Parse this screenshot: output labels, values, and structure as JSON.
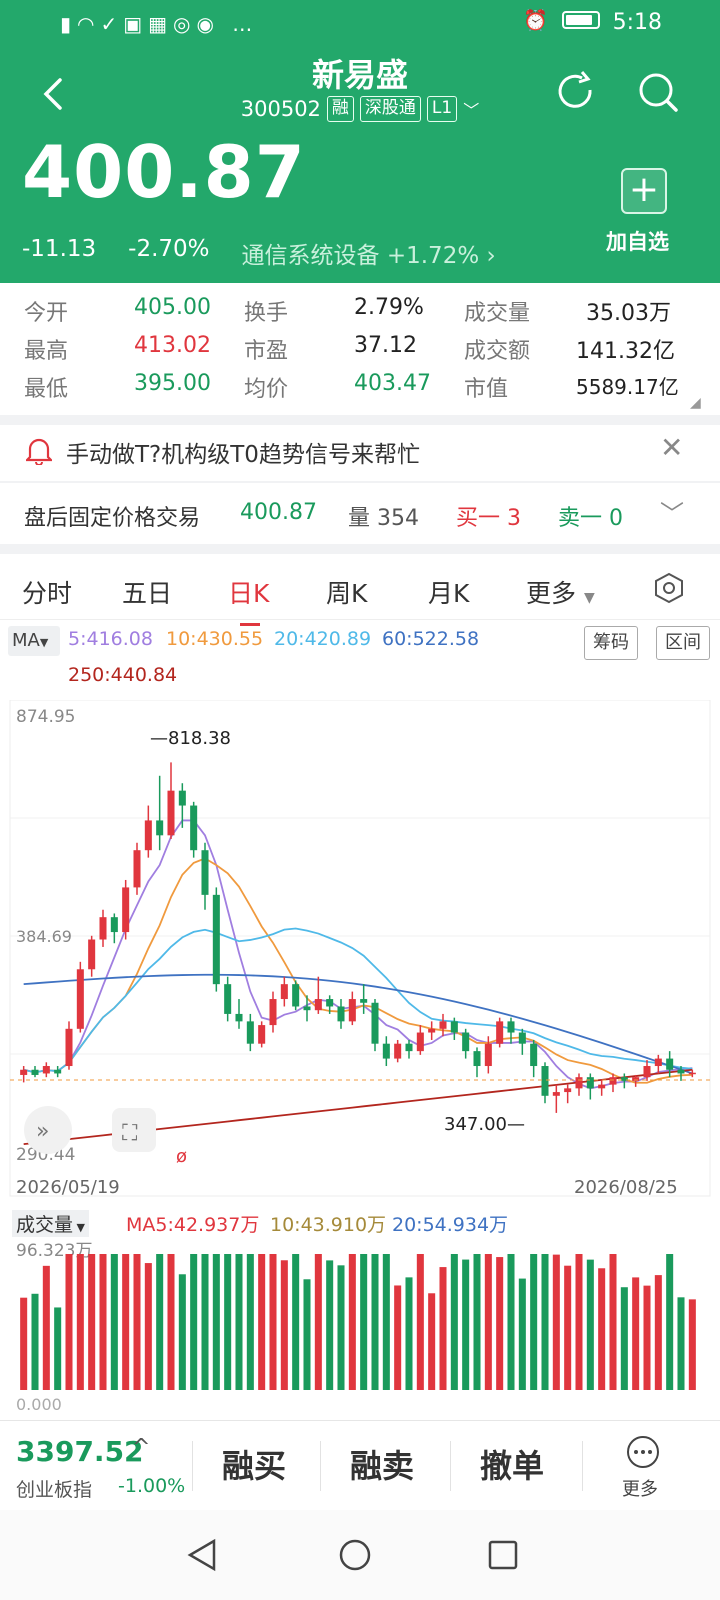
{
  "status": {
    "time": "5:18"
  },
  "header": {
    "stock_name": "新易盛",
    "code": "300502",
    "tags": [
      "融",
      "深股通",
      "L1"
    ],
    "price": "400.87",
    "change": "-11.13",
    "change_pct": "-2.70%",
    "sector": "通信系统设备 +1.72% ›",
    "add_label": "加自选",
    "colors": {
      "header_bg": "#23a86b",
      "up": "#e0363e",
      "down": "#1a9a5c"
    }
  },
  "quote": {
    "rows": [
      [
        {
          "label": "今开",
          "value": "405.00",
          "tone": "g"
        },
        {
          "label": "换手",
          "value": "2.79%",
          "tone": "k"
        },
        {
          "label": "成交量",
          "value": "35.03万",
          "tone": "k"
        }
      ],
      [
        {
          "label": "最高",
          "value": "413.02",
          "tone": "r"
        },
        {
          "label": "市盈",
          "value": "37.12",
          "tone": "k"
        },
        {
          "label": "成交额",
          "value": "141.32亿",
          "tone": "k"
        }
      ],
      [
        {
          "label": "最低",
          "value": "395.00",
          "tone": "g"
        },
        {
          "label": "均价",
          "value": "403.47",
          "tone": "g"
        },
        {
          "label": "市值",
          "value": "5589.17亿",
          "tone": "k"
        }
      ]
    ]
  },
  "notice": {
    "text": "手动做T?机构级T0趋势信号来帮忙"
  },
  "after_hours": {
    "label": "盘后固定价格交易",
    "price": "400.87",
    "volume": "量 354",
    "buy": "买一 3",
    "sell": "卖一 0"
  },
  "tabs": [
    "分时",
    "五日",
    "日K",
    "周K",
    "月K",
    "更多"
  ],
  "active_tab": 2,
  "ma": {
    "button": "MA",
    "ma5": "5:416.08",
    "ma10": "10:430.55",
    "ma20": "20:420.89",
    "ma60": "60:522.58",
    "ma250": "250:440.84",
    "chip_btn": "筹码",
    "range_btn": "区间",
    "colors": {
      "ma5": "#a07ee0",
      "ma10": "#f09a3e",
      "ma20": "#4fb9e8",
      "ma60": "#3f72c2",
      "ma250": "#b3261e"
    }
  },
  "chart_data": {
    "type": "candlestick",
    "y_top_label": "874.95",
    "y_bottom_label": "290.44",
    "mid_label": "384.69",
    "high_marker": "818.38",
    "low_marker": "347.00",
    "x_start": "2026/05/19",
    "x_end": "2026/08/25",
    "ylim": [
      290.44,
      874.95
    ],
    "candles": [
      [
        398,
        405,
        388,
        410
      ],
      [
        405,
        398,
        395,
        410
      ],
      [
        400,
        410,
        395,
        415
      ],
      [
        405,
        400,
        395,
        410
      ],
      [
        410,
        460,
        405,
        470
      ],
      [
        460,
        540,
        455,
        550
      ],
      [
        540,
        580,
        530,
        585
      ],
      [
        580,
        610,
        570,
        620
      ],
      [
        610,
        590,
        575,
        615
      ],
      [
        590,
        650,
        580,
        660
      ],
      [
        650,
        700,
        640,
        710
      ],
      [
        700,
        740,
        690,
        760
      ],
      [
        740,
        720,
        700,
        800
      ],
      [
        720,
        780,
        715,
        818
      ],
      [
        780,
        760,
        730,
        790
      ],
      [
        760,
        700,
        690,
        765
      ],
      [
        700,
        640,
        620,
        710
      ],
      [
        640,
        520,
        510,
        650
      ],
      [
        520,
        480,
        470,
        530
      ],
      [
        480,
        470,
        460,
        500
      ],
      [
        470,
        440,
        430,
        480
      ],
      [
        440,
        465,
        435,
        470
      ],
      [
        465,
        500,
        455,
        510
      ],
      [
        500,
        520,
        490,
        530
      ],
      [
        520,
        490,
        485,
        525
      ],
      [
        490,
        485,
        470,
        505
      ],
      [
        485,
        500,
        480,
        530
      ],
      [
        500,
        490,
        480,
        505
      ],
      [
        490,
        470,
        460,
        500
      ],
      [
        470,
        500,
        465,
        510
      ],
      [
        500,
        495,
        480,
        520
      ],
      [
        495,
        440,
        430,
        500
      ],
      [
        440,
        420,
        410,
        450
      ],
      [
        420,
        440,
        415,
        445
      ],
      [
        440,
        430,
        420,
        445
      ],
      [
        430,
        455,
        425,
        465
      ],
      [
        455,
        460,
        445,
        470
      ],
      [
        460,
        470,
        450,
        480
      ],
      [
        470,
        455,
        445,
        475
      ],
      [
        455,
        430,
        420,
        460
      ],
      [
        430,
        410,
        395,
        435
      ],
      [
        410,
        440,
        400,
        450
      ],
      [
        440,
        470,
        435,
        475
      ],
      [
        470,
        455,
        440,
        475
      ],
      [
        455,
        440,
        425,
        460
      ],
      [
        440,
        410,
        395,
        445
      ],
      [
        410,
        370,
        360,
        415
      ],
      [
        370,
        375,
        347,
        385
      ],
      [
        375,
        380,
        360,
        385
      ],
      [
        380,
        395,
        370,
        400
      ],
      [
        395,
        380,
        365,
        400
      ],
      [
        380,
        385,
        370,
        392
      ],
      [
        385,
        395,
        375,
        400
      ],
      [
        395,
        390,
        380,
        400
      ],
      [
        390,
        395,
        382,
        398
      ],
      [
        395,
        410,
        390,
        418
      ],
      [
        410,
        420,
        400,
        425
      ],
      [
        420,
        405,
        395,
        430
      ],
      [
        405,
        400,
        390,
        410
      ],
      [
        400,
        401,
        395,
        405
      ]
    ],
    "volume": {
      "label": "成交量",
      "max_label": "96.323万",
      "zero_label": "0.000",
      "ma5": "MA5:42.937万",
      "ma10": "10:43.910万",
      "ma20": "20:54.934万"
    }
  },
  "index": {
    "value": "3397.52",
    "name": "创业板指",
    "change": "-1.00%"
  },
  "actions": [
    "融买",
    "融卖",
    "撤单"
  ],
  "more_label": "更多"
}
